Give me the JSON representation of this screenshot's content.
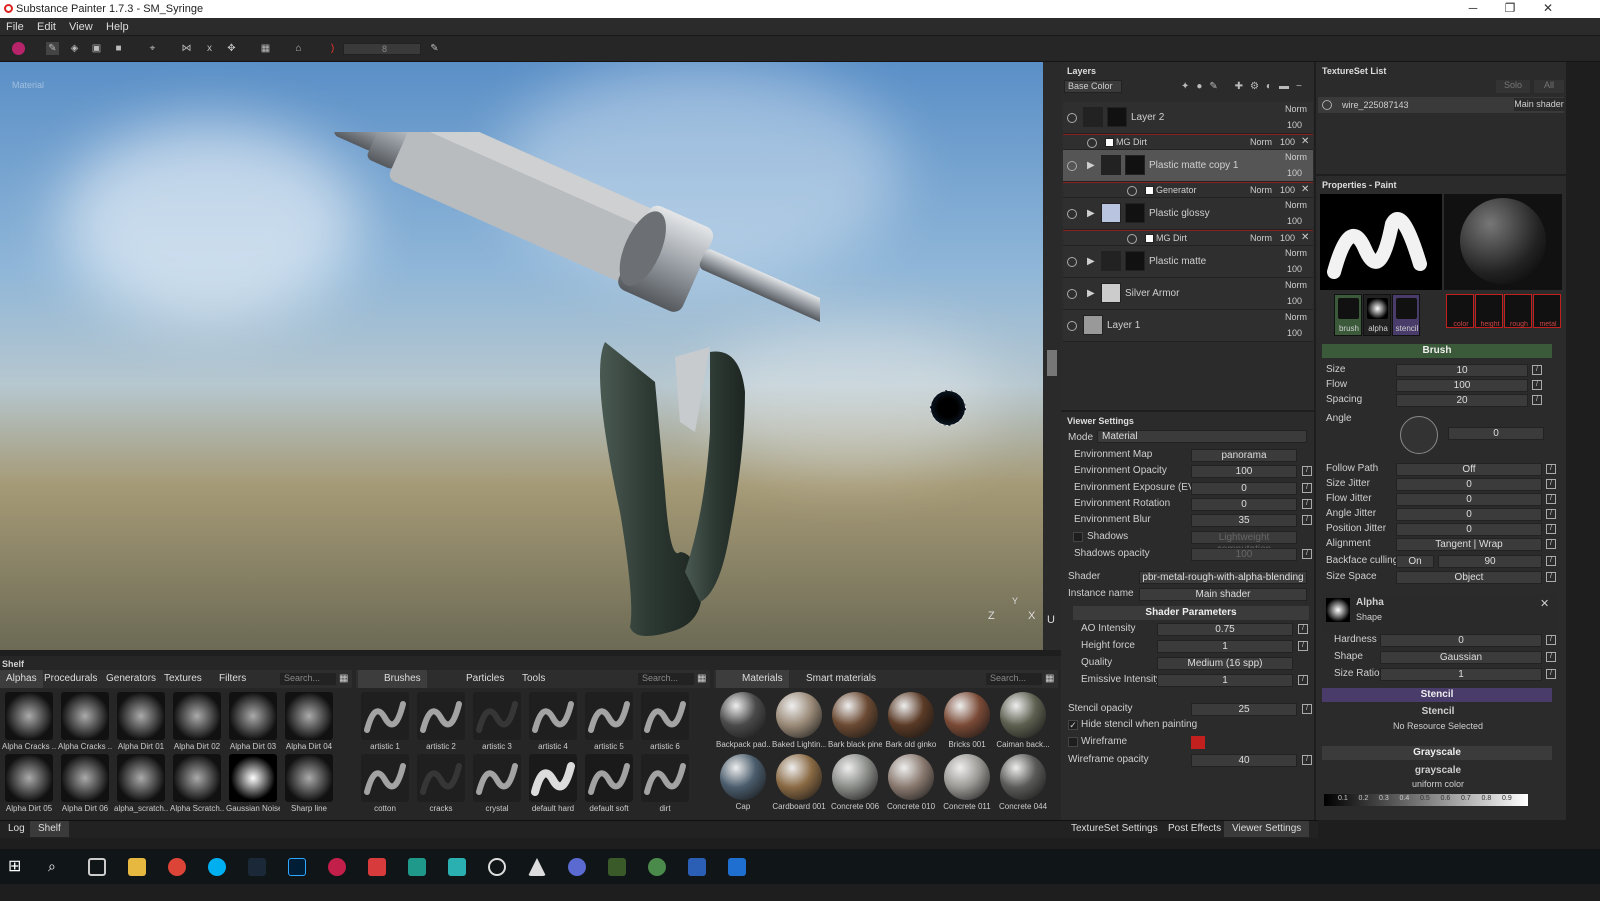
{
  "app": {
    "title": "Substance Painter 1.7.3 - SM_Syringe"
  },
  "window_controls": {
    "minimize": "─",
    "maximize": "❐",
    "close": "✕"
  },
  "menu": [
    "File",
    "Edit",
    "View",
    "Help"
  ],
  "toolbar": {
    "brush_value": "8"
  },
  "viewport": {
    "label": "Material",
    "axis": {
      "x": "X",
      "y": "Y",
      "z": "Z"
    },
    "side_label": "U"
  },
  "layers": {
    "title": "Layers",
    "channel": "Base Color",
    "rows": [
      {
        "name": "Layer 2",
        "blend": "Norm",
        "opacity": "100"
      },
      {
        "name": "MG Dirt",
        "blend": "Norm",
        "opacity": "100",
        "sub": true
      },
      {
        "name": "Plastic matte copy 1",
        "blend": "Norm",
        "opacity": "100"
      },
      {
        "name": "Generator",
        "blend": "Norm",
        "opacity": "100",
        "sub": true
      },
      {
        "name": "Plastic glossy",
        "blend": "Norm",
        "opacity": "100"
      },
      {
        "name": "MG Dirt",
        "blend": "Norm",
        "opacity": "100",
        "sub": true
      },
      {
        "name": "Plastic matte",
        "blend": "Norm",
        "opacity": "100"
      },
      {
        "name": "Silver Armor",
        "blend": "Norm",
        "opacity": "100"
      },
      {
        "name": "Layer 1",
        "blend": "Norm",
        "opacity": "100"
      }
    ]
  },
  "textureset": {
    "title": "TextureSet List",
    "solo": "Solo",
    "all": "All",
    "item": "wire_225087143",
    "shader": "Main shader"
  },
  "viewer": {
    "title": "Viewer Settings",
    "mode_label": "Mode",
    "mode": "Material",
    "env_map_label": "Environment Map",
    "env_map": "panorama",
    "env_opacity_label": "Environment Opacity",
    "env_opacity": "100",
    "env_exposure_label": "Environment Exposure (EV)",
    "env_exposure": "0",
    "env_rotation_label": "Environment Rotation",
    "env_rotation": "0",
    "env_blur_label": "Environment Blur",
    "env_blur": "35",
    "shadows_label": "Shadows",
    "shadows_value": "Lightweight computation",
    "shadows_opacity_label": "Shadows opacity",
    "shadows_opacity": "100",
    "shader_label": "Shader",
    "shader": "pbr-metal-rough-with-alpha-blending",
    "instance_label": "Instance name",
    "instance": "Main shader",
    "shader_params": "Shader Parameters",
    "ao_label": "AO Intensity",
    "ao": "0.75",
    "height_label": "Height force",
    "height": "1",
    "quality_label": "Quality",
    "quality": "Medium (16 spp)",
    "emissive_label": "Emissive Intensity",
    "emissive": "1",
    "stencil_opacity_label": "Stencil opacity",
    "stencil_opacity": "25",
    "hide_stencil_label": "Hide stencil when painting",
    "wireframe_label": "Wireframe",
    "wire_opacity_label": "Wireframe opacity",
    "wire_opacity": "40",
    "tabs": [
      "TextureSet Settings",
      "Post Effects",
      "Viewer Settings"
    ]
  },
  "properties": {
    "title": "Properties - Paint",
    "slots": [
      "brush",
      "alpha",
      "stencil"
    ],
    "channels": [
      "color",
      "height",
      "rough",
      "metal"
    ],
    "brush_title": "Brush",
    "size_label": "Size",
    "size": "10",
    "flow_label": "Flow",
    "flow": "100",
    "spacing_label": "Spacing",
    "spacing": "20",
    "angle_label": "Angle",
    "angle": "0",
    "follow_label": "Follow Path",
    "follow": "Off",
    "sizej_label": "Size Jitter",
    "sizej": "0",
    "flowj_label": "Flow Jitter",
    "flowj": "0",
    "anglej_label": "Angle Jitter",
    "anglej": "0",
    "posj_label": "Position Jitter",
    "posj": "0",
    "align_label": "Alignment",
    "align": "Tangent | Wrap",
    "backface_label": "Backface culling",
    "backface_on": "On",
    "backface": "90",
    "space_label": "Size Space",
    "space": "Object",
    "alpha_title": "Alpha",
    "alpha_sub": "Shape",
    "hardness_label": "Hardness",
    "hardness": "0",
    "shape_label": "Shape",
    "shape": "Gaussian",
    "ratio_label": "Size Ratio",
    "ratio": "1",
    "stencil_title": "Stencil",
    "stencil_sub": "Stencil",
    "stencil_none": "No Resource Selected",
    "gray_title": "Grayscale",
    "gray_sub": "grayscale",
    "gray_sub2": "uniform color",
    "gray_ticks": [
      "0.1",
      "0.2",
      "0.3",
      "0.4",
      "0.5",
      "0.6",
      "0.7",
      "0.8",
      "0.9"
    ]
  },
  "shelf": {
    "title": "Shelf",
    "tabs1": [
      "Alphas",
      "Procedurals",
      "Generators",
      "Textures",
      "Filters"
    ],
    "search": "Search...",
    "alphas": [
      "Alpha Cracks ...",
      "Alpha Cracks ...",
      "Alpha Dirt 01",
      "Alpha Dirt 02",
      "Alpha Dirt 03",
      "Alpha Dirt 04",
      "Alpha Dirt 05",
      "Alpha Dirt 06",
      "alpha_scratch...",
      "Alpha Scratch...",
      "Gaussian Noise",
      "Sharp line"
    ],
    "tabs2": [
      "Brushes",
      "Particles",
      "Tools"
    ],
    "brushes": [
      "artistic 1",
      "artistic 2",
      "artistic 3",
      "artistic 4",
      "artistic 5",
      "artistic 6",
      "cotton",
      "cracks",
      "crystal",
      "default hard",
      "default soft",
      "dirt"
    ],
    "tabs3": [
      "Materials",
      "Smart materials"
    ],
    "materials": [
      "Backpack pad...",
      "Baked Lightin...",
      "Bark black pine",
      "Bark old ginko",
      "Bricks 001",
      "Caiman back...",
      "Cap",
      "Cardboard 001",
      "Concrete 006",
      "Concrete 010",
      "Concrete 011",
      "Concrete 044"
    ],
    "material_colors": [
      "#4a4a4a",
      "#9a8a78",
      "#6b4a33",
      "#5a3a26",
      "#7a4a36",
      "#5d6050",
      "#4a5c6c",
      "#8a6a44",
      "#8a8c88",
      "#8a7a70",
      "#9a9894",
      "#5a5a58"
    ],
    "bottom": [
      "Log",
      "Shelf"
    ]
  },
  "colors": {
    "accent_red": "#c21f1f",
    "brush_green": "#3a5a3a",
    "stencil_purple": "#4a3c6a"
  }
}
